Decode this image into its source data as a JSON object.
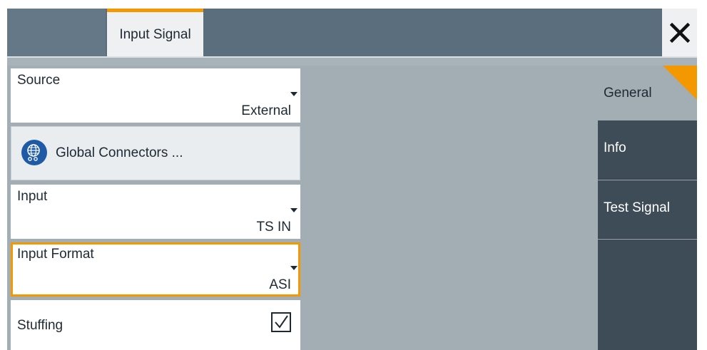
{
  "header": {
    "active_tab": "Input Signal",
    "close_icon": "close-icon"
  },
  "fields": {
    "source": {
      "label": "Source",
      "value": "External"
    },
    "global_connectors": {
      "label": "Global Connectors ...",
      "icon": "globe-connector-icon"
    },
    "input": {
      "label": "Input",
      "value": "TS IN"
    },
    "input_format": {
      "label": "Input Format",
      "value": "ASI"
    },
    "stuffing": {
      "label": "Stuffing",
      "checked": true
    }
  },
  "nav": {
    "items": [
      {
        "label": "General",
        "active": true
      },
      {
        "label": "Info",
        "active": false
      },
      {
        "label": "Test Signal",
        "active": false
      }
    ]
  },
  "colors": {
    "accent": "#f39800",
    "header_bg": "#5a6e7d",
    "content_bg": "#a3adb4",
    "nav_bg": "#3d4c57",
    "icon_blue": "#1f5aa6"
  }
}
